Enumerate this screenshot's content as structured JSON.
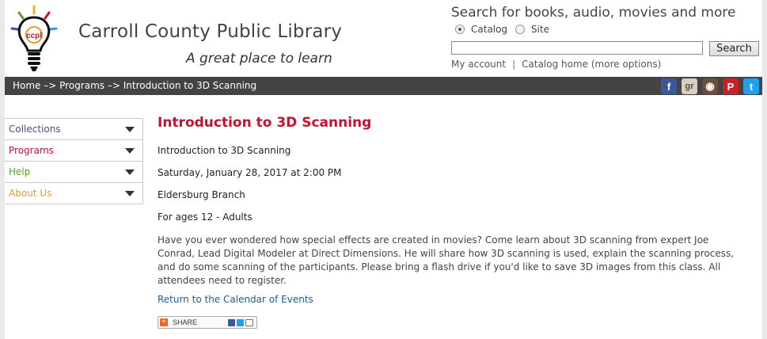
{
  "header": {
    "site_title": "Carroll County Public Library",
    "tagline": "A great place to learn",
    "logo_text": "ccpl"
  },
  "search": {
    "heading": "Search for books, audio, movies and more",
    "scope_options": [
      "Catalog",
      "Site"
    ],
    "selected_scope": "Catalog",
    "query_value": "",
    "button_label": "Search",
    "links": [
      "My account",
      "Catalog home (more options)"
    ],
    "link_separator": "|"
  },
  "breadcrumb": {
    "items": [
      "Home",
      "Programs",
      "Introduction to 3D Scanning"
    ],
    "separator": "–>"
  },
  "social": [
    {
      "name": "facebook-icon",
      "glyph": "f",
      "color": "#3b5998"
    },
    {
      "name": "goodreads-icon",
      "glyph": "gr",
      "color": "#d6d0c4"
    },
    {
      "name": "instagram-icon",
      "glyph": "◉",
      "color": "#6b4f3a"
    },
    {
      "name": "pinterest-icon",
      "glyph": "P",
      "color": "#cb2027"
    },
    {
      "name": "twitter-icon",
      "glyph": "t",
      "color": "#1da1f2"
    }
  ],
  "sidebar": {
    "items": [
      {
        "label": "Collections",
        "color": "#4a4a9a"
      },
      {
        "label": "Programs",
        "color": "#c8102e"
      },
      {
        "label": "Help",
        "color": "#5aa02c"
      },
      {
        "label": "About Us",
        "color": "#e89a2c"
      }
    ]
  },
  "main": {
    "title": "Introduction to 3D Scanning",
    "event_name": "Introduction to 3D Scanning",
    "date_time": "Saturday, January 28, 2017 at 2:00 PM",
    "branch": "Eldersburg Branch",
    "ages": "For ages 12 - Adults",
    "description": "Have you ever wondered how special effects are created in movies? Come learn about 3D scanning from expert Joe Conrad, Lead Digital Modeler at Direct Dimensions. He will share how 3D scanning is used, explain the scanning process, and do some scanning of the participants. Please bring a flash drive if you'd like to save 3D images from this class. All attendees need to register.",
    "return_link": "Return to the Calendar of Events",
    "share_label": "SHARE"
  },
  "colors": {
    "accent_red": "#c8102e",
    "bar_dark": "#444444",
    "link_blue": "#1f5a95"
  }
}
